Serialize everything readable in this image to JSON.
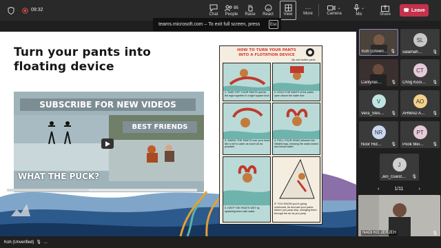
{
  "topbar": {
    "time": "09:32",
    "people_count": "95",
    "buttons": [
      "Chat",
      "People",
      "Raise",
      "React",
      "View",
      "More"
    ],
    "camera": "Camera",
    "mic": "Mic",
    "share": "Share",
    "leave": "Leave"
  },
  "banner": {
    "text": "teams.microsoft.com – To exit full screen, press",
    "key": "Esc"
  },
  "slide": {
    "title": "Turn your pants into\nfloating device",
    "video": {
      "banner": "SUBSCRIBE FOR NEW VIDEOS",
      "sub": "BEST FRIENDS",
      "caption": "WHAT THE PUCK?",
      "progress": 0.43
    },
    "infographic": {
      "title": "HOW TO TURN YOUR PANTS INTO A FLOTATION DEVICE",
      "steps": [
        "1. TAKE OFF YOUR PANTS and tie the legs together in a tight square knot.",
        "2. HOLD THE WAIST of the pants open above the water line.",
        "3. SWING THE PANTS over your head like a net to catch as much air as possible.",
        "4. PULL YOUR HEAD between the inflated legs, keeping the waist closed and below water.",
        "5. KEEP THE PANTS WET by splashing them with water.",
        "IF YOU KNOW you're going overboard, tie and wet your pants before you jump ship, swinging them through the air as you jump."
      ]
    }
  },
  "participants": [
    {
      "name": "Koh (Unveri…",
      "type": "photo",
      "color": "#5a4d44"
    },
    {
      "name": "salamah…",
      "initials": "SL",
      "color": "#c7c7c7"
    },
    {
      "name": "Cantyras…",
      "type": "photo",
      "color": "#6b4b3a"
    },
    {
      "name": "Chng Kooi…",
      "initials": "CT",
      "color": "#e8c9dc"
    },
    {
      "name": "Vera_Stes…",
      "initials": "V",
      "color": "#bfe3e0"
    },
    {
      "name": "AHMAD A…",
      "initials": "AO",
      "color": "#f3d08a"
    },
    {
      "name": "Noor Hid…",
      "initials": "NR",
      "color": "#c9d7f0"
    },
    {
      "name": "Pook Mei…",
      "initials": "PT",
      "color": "#e6c8d8"
    },
    {
      "name": "Jen_Guest…",
      "initials": "J",
      "color": "#cfcfcf"
    }
  ],
  "pager": "1/11",
  "self": {
    "name": "NADI KG JERJEH"
  },
  "bottombar": {
    "presenter": "Koh (Unverified)"
  }
}
